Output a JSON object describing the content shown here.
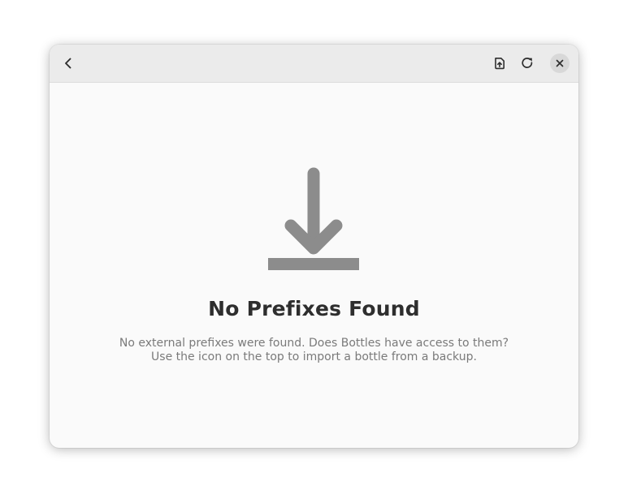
{
  "window": {
    "headerbar": {
      "back_icon": "go-previous-icon",
      "import_icon": "document-import-icon",
      "refresh_icon": "view-refresh-icon",
      "close_icon": "window-close-icon"
    }
  },
  "status_page": {
    "icon": "download-arrow-icon",
    "title": "No Prefixes Found",
    "description_line1": "No external prefixes were found. Does Bottles have access to them?",
    "description_line2": "Use the icon on the top to import a bottle from a backup."
  },
  "colors": {
    "window_bg": "#fafafa",
    "headerbar_bg": "#ebebeb",
    "icon_gray": "#8c8c8c",
    "title_text": "#2e2e2e",
    "description_text": "#7a7a7a"
  }
}
